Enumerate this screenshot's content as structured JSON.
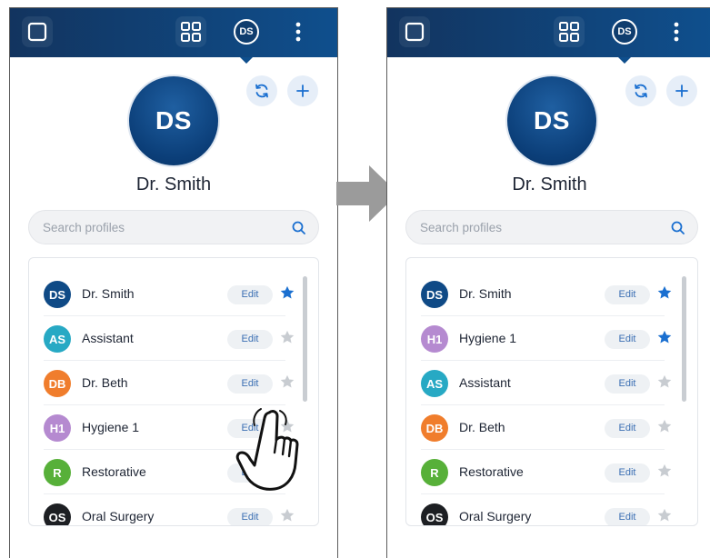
{
  "colors": {
    "header": "#12345f",
    "accent": "#1a6fd0",
    "star_active": "#1a6fd0",
    "star_inactive": "#c8ccd1"
  },
  "before": {
    "header_avatar": "DS",
    "avatar_initials": "DS",
    "user_name": "Dr. Smith",
    "search_placeholder": "Search profiles",
    "profiles": [
      {
        "initials": "DS",
        "name": "Dr. Smith",
        "edit": "Edit",
        "starred": true,
        "color": "#0f4a86"
      },
      {
        "initials": "AS",
        "name": "Assistant",
        "edit": "Edit",
        "starred": false,
        "color": "#27a9c4"
      },
      {
        "initials": "DB",
        "name": "Dr. Beth",
        "edit": "Edit",
        "starred": false,
        "color": "#f07d2c"
      },
      {
        "initials": "H1",
        "name": "Hygiene 1",
        "edit": "Edit",
        "starred": false,
        "color": "#b58ad0"
      },
      {
        "initials": "R",
        "name": "Restorative",
        "edit": "Edit",
        "starred": false,
        "color": "#57b039"
      },
      {
        "initials": "OS",
        "name": "Oral Surgery",
        "edit": "Edit",
        "starred": false,
        "color": "#1d1f23"
      }
    ]
  },
  "after": {
    "header_avatar": "DS",
    "avatar_initials": "DS",
    "user_name": "Dr. Smith",
    "search_placeholder": "Search profiles",
    "profiles": [
      {
        "initials": "DS",
        "name": "Dr. Smith",
        "edit": "Edit",
        "starred": true,
        "color": "#0f4a86"
      },
      {
        "initials": "H1",
        "name": "Hygiene 1",
        "edit": "Edit",
        "starred": true,
        "color": "#b58ad0"
      },
      {
        "initials": "AS",
        "name": "Assistant",
        "edit": "Edit",
        "starred": false,
        "color": "#27a9c4"
      },
      {
        "initials": "DB",
        "name": "Dr. Beth",
        "edit": "Edit",
        "starred": false,
        "color": "#f07d2c"
      },
      {
        "initials": "R",
        "name": "Restorative",
        "edit": "Edit",
        "starred": false,
        "color": "#57b039"
      },
      {
        "initials": "OS",
        "name": "Oral Surgery",
        "edit": "Edit",
        "starred": false,
        "color": "#1d1f23"
      }
    ]
  }
}
